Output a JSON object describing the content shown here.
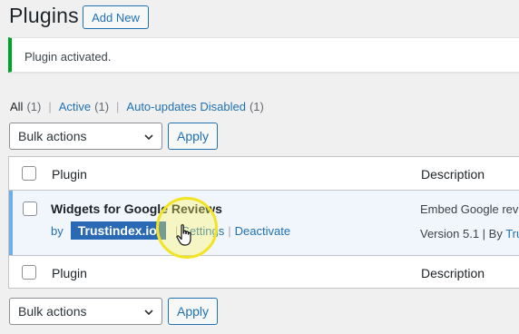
{
  "header": {
    "title": "Plugins",
    "add_new_label": "Add New"
  },
  "notice": {
    "text": "Plugin activated.",
    "accent_color": "#00a32a"
  },
  "views": {
    "all_label": "All",
    "all_count": "(1)",
    "active_label": "Active",
    "active_count": "(1)",
    "autoupdates_label": "Auto-updates Disabled",
    "autoupdates_count": "(1)",
    "separator": "|"
  },
  "bulk_top": {
    "selected": "Bulk actions",
    "apply_label": "Apply"
  },
  "bulk_bottom": {
    "selected": "Bulk actions",
    "apply_label": "Apply"
  },
  "table": {
    "columns": [
      "Plugin",
      "Description"
    ],
    "footer_columns": [
      "Plugin",
      "Description"
    ],
    "rows": [
      {
        "name": "Widgets for Google Reviews",
        "by_label": "by",
        "author": "Trustindex.io",
        "actions": [
          "Settings",
          "Deactivate"
        ],
        "action_separator": "|",
        "description": "Embed Google revi",
        "version_text": "Version 5.1 | By",
        "author_short": "Trus",
        "active_color": "#72aee6"
      }
    ]
  },
  "icons": {
    "select_chevron": "chevron-down-icon",
    "cursor": "hand-pointer-icon"
  },
  "colors": {
    "link": "#2271b1",
    "highlight": "#2a6ab5",
    "cursor_ring": "#f2e424"
  }
}
